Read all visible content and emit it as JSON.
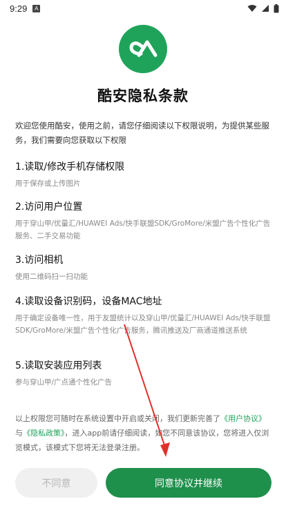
{
  "status_bar": {
    "time": "9:29",
    "notification_icon": "notification-a-icon",
    "icons": [
      "wifi-icon",
      "signal-icon",
      "battery-icon"
    ]
  },
  "app": {
    "logo_icon": "coolapk-logo-icon",
    "brand_color": "#1fa35a"
  },
  "title": "酷安隐私条款",
  "intro": "欢迎您使用酷安，使用之前，请您仔细阅读以下权限说明，为提供某些服务，我们需要向您获取以下权限",
  "permissions": [
    {
      "title": "1.读取/修改手机存储权限",
      "desc": "用于保存或上传图片"
    },
    {
      "title": "2.访问用户位置",
      "desc": "用于穿山甲/优量汇/HUAWEI Ads/快手联盟SDK/GroMore/米盟广告个性化广告服务、二手交易功能"
    },
    {
      "title": "3.访问相机",
      "desc": "使用二维码扫一扫功能"
    },
    {
      "title": "4.读取设备识别码，设备MAC地址",
      "desc": "用于确定设备唯一性，用于友盟统计以及穿山甲/优量汇/HUAWEI Ads/快手联盟SDK/GroMore/米盟广告个性化广告服务，腾讯推送及厂商通道推送系统"
    },
    {
      "title": "5.读取安装应用列表",
      "desc": "参与穿山甲/广点通个性化广告"
    }
  ],
  "notice": {
    "part1": "以上权限您可随时在系统设置中开启或关闭，我们更新完善了",
    "link1": "《用户协议》",
    "part2": "与",
    "link2": "《隐私政策》",
    "part3": "，进入app前请仔细阅读，如您不同意该协议，您将进入仅浏览模式，该模式下您将无法登录注册。"
  },
  "buttons": {
    "decline_label": "不同意",
    "accept_label": "同意协议并继续"
  },
  "annotation": {
    "color": "#e0302a"
  }
}
